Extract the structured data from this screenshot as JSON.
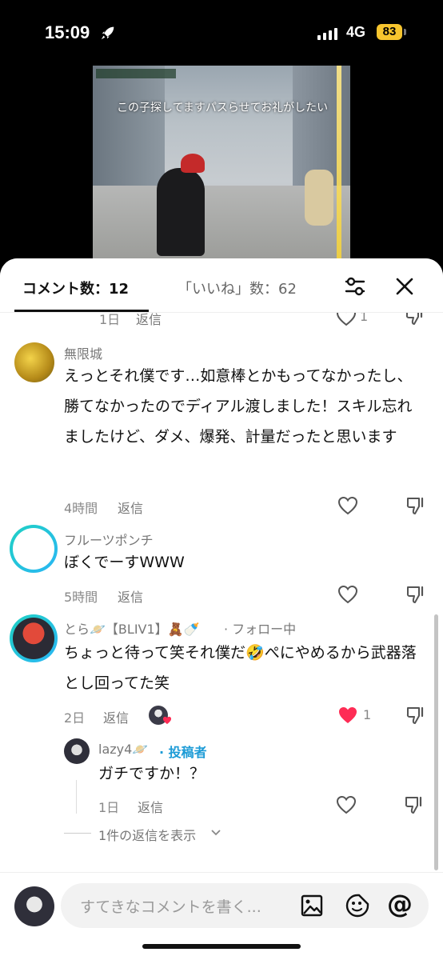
{
  "status_bar": {
    "time": "15:09",
    "network": "4G",
    "battery": "83"
  },
  "video": {
    "caption": "この子探してますパスらせてお礼がしたい"
  },
  "header": {
    "comments_tab": "コメント数：12",
    "likes_tab": "「いいね」数：62"
  },
  "top_partial": {
    "time": "1日",
    "reply": "返信",
    "likes": "1"
  },
  "comments": [
    {
      "name": "無限城",
      "text": "えっとそれ僕です…如意棒とかもってなかったし、勝てなかったのでディアル渡しました！スキル忘れましたけど、ダメ、爆発、計量だったと思います",
      "time": "4時間",
      "reply": "返信"
    },
    {
      "name": "フルーツポンチ",
      "text": "ぼくでーすWWW",
      "time": "5時間",
      "reply": "返信"
    },
    {
      "name": "とら🪐【BLIV1】🧸🍼",
      "name_suffix": "· フォロー中",
      "text": "ちょっと待って笑それ僕だ🤣ぺにやめるから武器落とし回ってた笑",
      "time": "2日",
      "reply": "返信",
      "likes": "1"
    }
  ],
  "reply_comment": {
    "name": "lazy4🪐",
    "badge": "· 投稿者",
    "text": "ガチですか！？",
    "time": "1日",
    "reply": "返信"
  },
  "show_replies": "1件の返信を表示",
  "input": {
    "placeholder": "すてきなコメントを書く..."
  },
  "colors": {
    "accent_heart": "#fe2c55",
    "creator_badge": "#1c9bd6",
    "name_gray": "#777777"
  }
}
